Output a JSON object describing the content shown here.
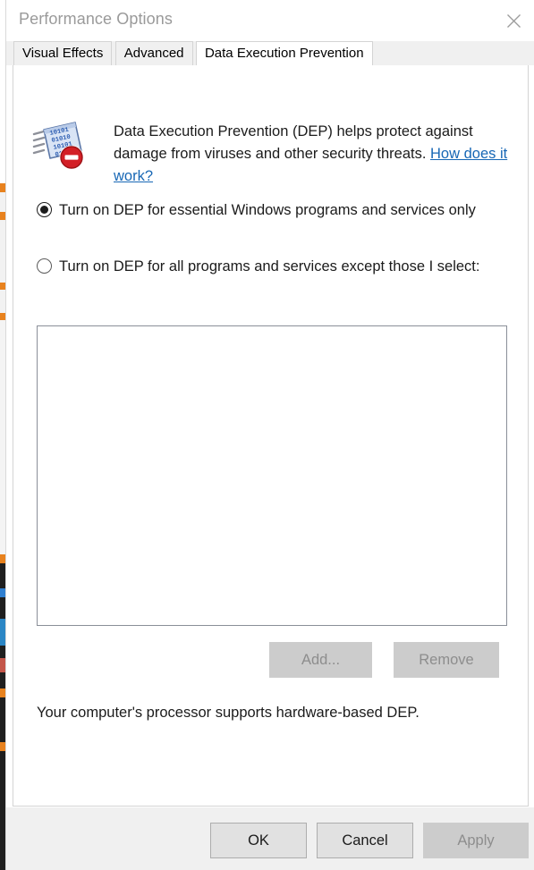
{
  "window": {
    "title": "Performance Options",
    "close_icon": "close-icon"
  },
  "tabs": [
    {
      "label": "Visual Effects",
      "active": false
    },
    {
      "label": "Advanced",
      "active": false
    },
    {
      "label": "Data Execution Prevention",
      "active": true
    }
  ],
  "dep": {
    "icon_name": "dep-chip-blocked-icon",
    "description_text": "Data Execution Prevention (DEP) helps protect against damage from viruses and other security threats. ",
    "link_text": "How does it work?",
    "options": [
      {
        "id": "essential",
        "label": "Turn on DEP for essential Windows programs and services only",
        "selected": true
      },
      {
        "id": "all-except",
        "label": "Turn on DEP for all programs and services except those I select:",
        "selected": false
      }
    ],
    "exclusion_list": {
      "items": [],
      "empty": true
    },
    "add_label": "Add...",
    "add_enabled": false,
    "remove_label": "Remove",
    "remove_enabled": false,
    "status_text": "Your computer's processor supports hardware-based DEP."
  },
  "footer": {
    "ok_label": "OK",
    "cancel_label": "Cancel",
    "apply_label": "Apply",
    "apply_enabled": false
  },
  "colors": {
    "link": "#1767b5",
    "title_text": "#9a9a9a",
    "body_text": "#1b1b1b",
    "footer_bg": "#f0f0f0",
    "disabled_bg": "#cccccc",
    "disabled_text": "#8d8d8d",
    "button_bg": "#e1e1e1",
    "icon_blue": "#2f5fb3",
    "icon_red": "#d31f26"
  }
}
